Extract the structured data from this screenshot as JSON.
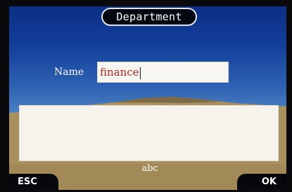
{
  "header": {
    "title": "Department"
  },
  "form": {
    "name_label": "Name",
    "name_value": "finance"
  },
  "input_mode": {
    "label": "abc"
  },
  "softkeys": {
    "left_label": "ESC",
    "right_label": "OK"
  },
  "colors": {
    "sky_top": "#0c2e86",
    "title_bg": "#04070f",
    "input_text": "#b0281a",
    "softkey_bg": "#06080d"
  }
}
